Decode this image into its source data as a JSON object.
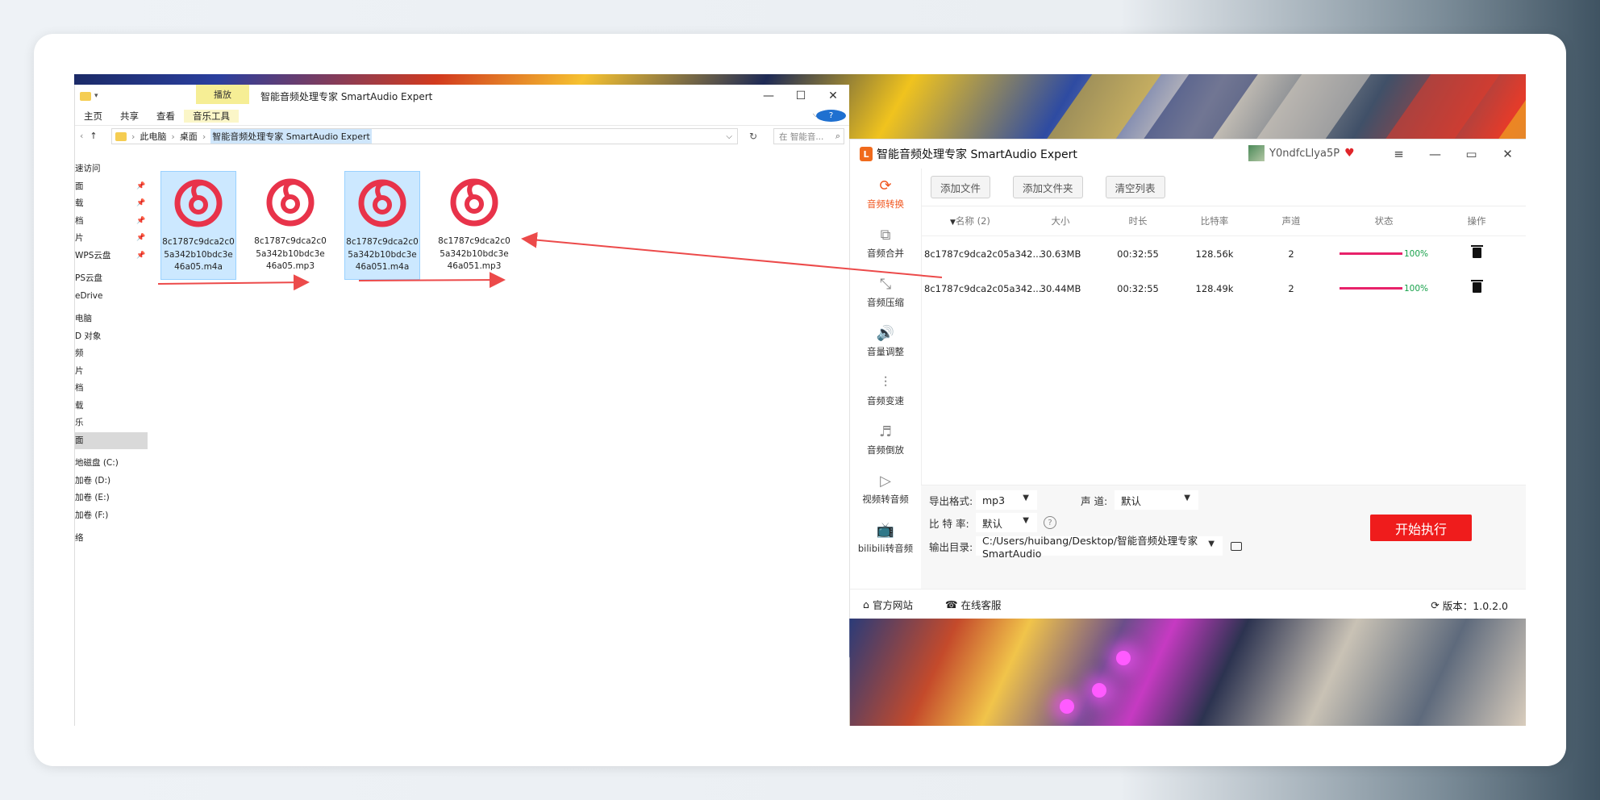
{
  "explorer": {
    "title": "智能音频处理专家 SmartAudio Expert",
    "ribbon_context_tab": "播放",
    "tabs": [
      "主页",
      "共享",
      "查看",
      "音乐工具"
    ],
    "breadcrumb": [
      "此电脑",
      "桌面",
      "智能音频处理专家 SmartAudio Expert"
    ],
    "search_placeholder": "在 智能音...",
    "sidebar": [
      {
        "label": "速访问",
        "pin": false
      },
      {
        "label": "面",
        "pin": true
      },
      {
        "label": "载",
        "pin": true
      },
      {
        "label": "档",
        "pin": true
      },
      {
        "label": "片",
        "pin": true
      },
      {
        "label": "WPS云盘",
        "pin": true
      },
      {
        "label": "PS云盘",
        "pin": false
      },
      {
        "label": "eDrive",
        "pin": false
      },
      {
        "label": "电脑",
        "pin": false
      },
      {
        "label": "D 对象",
        "pin": false
      },
      {
        "label": "频",
        "pin": false
      },
      {
        "label": "片",
        "pin": false
      },
      {
        "label": "档",
        "pin": false
      },
      {
        "label": "载",
        "pin": false
      },
      {
        "label": "乐",
        "pin": false
      },
      {
        "label": "面",
        "pin": false,
        "selected": true
      },
      {
        "label": "地磁盘 (C:)",
        "pin": false
      },
      {
        "label": "加卷 (D:)",
        "pin": false
      },
      {
        "label": "加卷 (E:)",
        "pin": false
      },
      {
        "label": "加卷 (F:)",
        "pin": false
      },
      {
        "label": "络",
        "pin": false
      }
    ],
    "files": [
      {
        "name": "8c1787c9dca2c05a342b10bdc3e46a05.m4a",
        "selected": true
      },
      {
        "name": "8c1787c9dca2c05a342b10bdc3e46a05.mp3",
        "selected": false
      },
      {
        "name": "8c1787c9dca2c05a342b10bdc3e46a051.m4a",
        "selected": true
      },
      {
        "name": "8c1787c9dca2c05a342b10bdc3e46a051.mp3",
        "selected": false
      }
    ]
  },
  "app": {
    "name": "智能音频处理专家 SmartAudio Expert",
    "logo_letter": "L",
    "user": "Y0ndfcLlya5P",
    "sidebar": [
      {
        "label": "音频转换",
        "icon": "convert-icon",
        "active": true
      },
      {
        "label": "音频合并",
        "icon": "merge-icon",
        "active": false
      },
      {
        "label": "音频压缩",
        "icon": "compress-icon",
        "active": false
      },
      {
        "label": "音量调整",
        "icon": "volume-icon",
        "active": false
      },
      {
        "label": "音频变速",
        "icon": "speed-icon",
        "active": false
      },
      {
        "label": "音频倒放",
        "icon": "reverse-icon",
        "active": false
      },
      {
        "label": "视频转音频",
        "icon": "video-icon",
        "active": false
      },
      {
        "label": "bilibili转音频",
        "icon": "bilibili-icon",
        "active": false
      }
    ],
    "toolbar": {
      "add_file": "添加文件",
      "add_folder": "添加文件夹",
      "clear_list": "清空列表"
    },
    "table": {
      "headers": {
        "name": "名称 (2)",
        "size": "大小",
        "duration": "时长",
        "bitrate": "比特率",
        "channels": "声道",
        "status": "状态",
        "action": "操作"
      },
      "rows": [
        {
          "name": "8c1787c9dca2c05a342...",
          "size": "30.63MB",
          "duration": "00:32:55",
          "bitrate": "128.56k",
          "channels": "2",
          "progress": "100%"
        },
        {
          "name": "8c1787c9dca2c05a342...",
          "size": "30.44MB",
          "duration": "00:32:55",
          "bitrate": "128.49k",
          "channels": "2",
          "progress": "100%"
        }
      ]
    },
    "settings": {
      "format_label": "导出格式:",
      "format_value": "mp3",
      "channel_label": "声 道:",
      "channel_value": "默认",
      "bitrate_label": "比 特 率:",
      "bitrate_value": "默认",
      "output_label": "输出目录:",
      "output_value": "C:/Users/huibang/Desktop/智能音频处理专家 SmartAudio",
      "start_button": "开始执行"
    },
    "footer": {
      "website": "官方网站",
      "support": "在线客服",
      "version": "版本：1.0.2.0"
    }
  },
  "colors": {
    "accent": "#f0561f",
    "start": "#ef1c1c",
    "progress": "#e8226a",
    "annotation_arrow": "#ec4a4a"
  }
}
